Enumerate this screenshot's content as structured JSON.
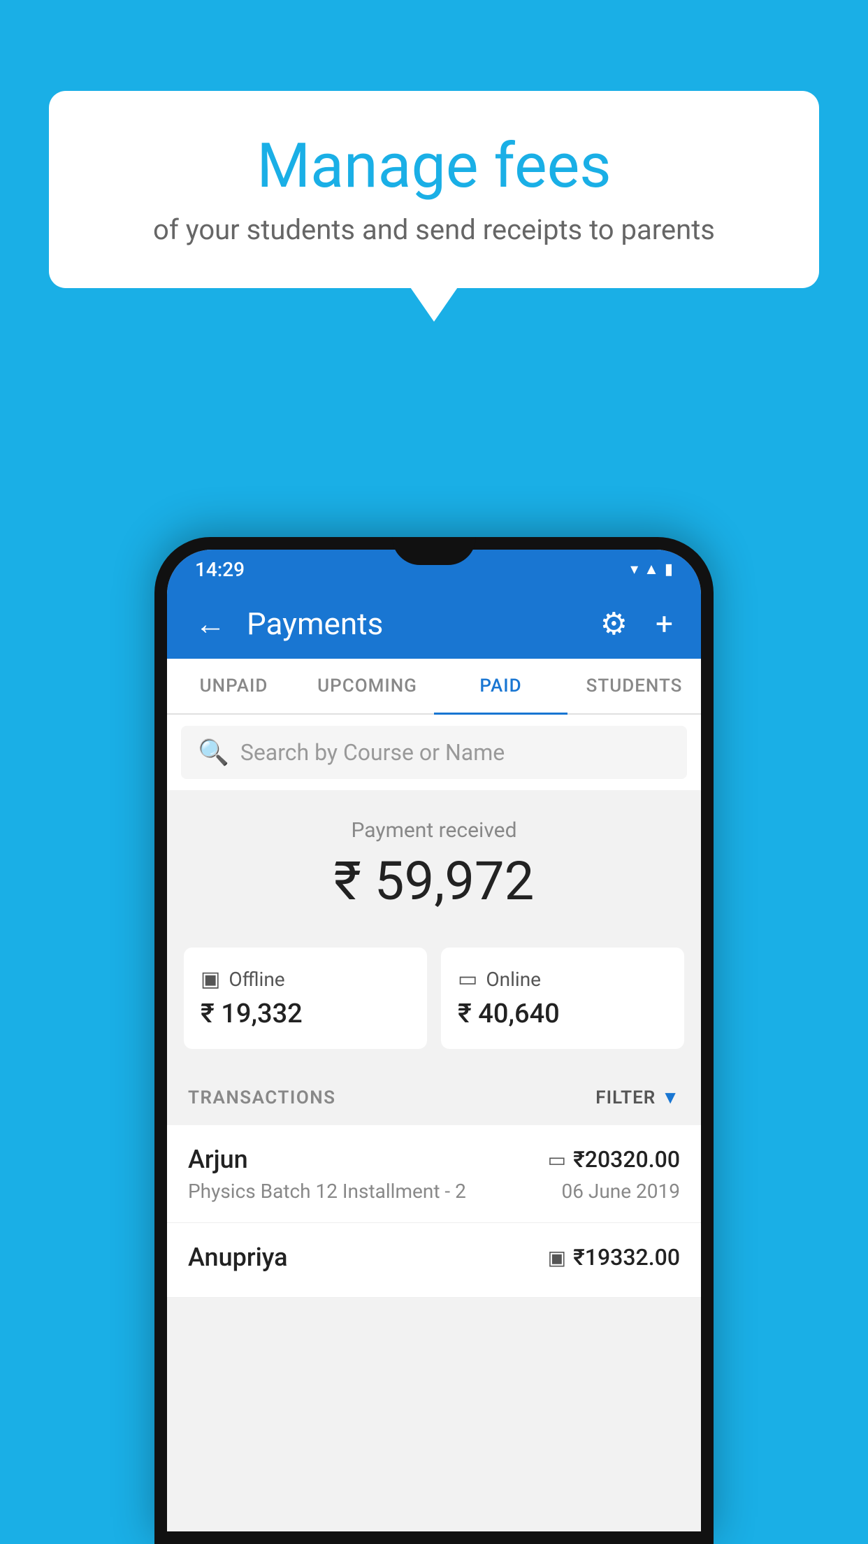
{
  "background_color": "#1AAFE6",
  "speech_bubble": {
    "title": "Manage fees",
    "subtitle": "of your students and send receipts to parents"
  },
  "status_bar": {
    "time": "14:29",
    "icons": [
      "wifi",
      "signal",
      "battery"
    ]
  },
  "app_bar": {
    "title": "Payments",
    "back_icon": "←",
    "settings_icon": "⚙",
    "add_icon": "+"
  },
  "tabs": [
    {
      "label": "UNPAID",
      "active": false
    },
    {
      "label": "UPCOMING",
      "active": false
    },
    {
      "label": "PAID",
      "active": true
    },
    {
      "label": "STUDENTS",
      "active": false
    }
  ],
  "search": {
    "placeholder": "Search by Course or Name"
  },
  "payment_received": {
    "label": "Payment received",
    "amount": "₹ 59,972"
  },
  "payment_modes": [
    {
      "label": "Offline",
      "icon": "offline",
      "amount": "₹ 19,332"
    },
    {
      "label": "Online",
      "icon": "online",
      "amount": "₹ 40,640"
    }
  ],
  "transactions_label": "TRANSACTIONS",
  "filter_label": "FILTER",
  "transactions": [
    {
      "name": "Arjun",
      "course": "Physics Batch 12 Installment - 2",
      "date": "06 June 2019",
      "amount": "₹20320.00",
      "mode": "online"
    },
    {
      "name": "Anupriya",
      "course": "",
      "date": "",
      "amount": "₹19332.00",
      "mode": "offline"
    }
  ]
}
